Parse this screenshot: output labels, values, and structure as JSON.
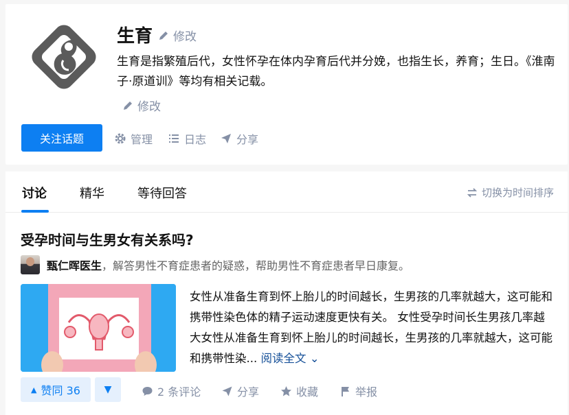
{
  "topic": {
    "title": "生育",
    "edit_label": "修改",
    "description": "生育是指繁殖后代，女性怀孕在体内孕育后代并分娩，也指生长，养育；生日。《淮南子·原道训》等均有相关记载。",
    "edit_label_2": "修改",
    "follow_button": "关注话题",
    "actions": {
      "manage": "管理",
      "log": "日志",
      "share": "分享"
    },
    "icon": "fetus-diamond-logo"
  },
  "tabs": {
    "items": [
      "讨论",
      "精华",
      "等待回答"
    ],
    "active": "讨论",
    "sort_toggle": "切换为时间排序"
  },
  "post": {
    "title": "受孕时间与生男女有关系吗?",
    "author_name": "甄仁晖医生",
    "author_bio": "，解答男性不育症患者的疑惑，帮助男性不育症患者早日康复。",
    "excerpt": "女性从准备生育到怀上胎儿的时间越长，生男孩的几率就越大，这可能和携带性染色体的精子运动速度更快有关。 女性受孕时间长生男孩几率越大女性从准备生育到怀上胎儿的时间越长，生男孩的几率就越大，这可能和携带性染...",
    "read_more": "阅读全文",
    "vote_label": "赞同 36",
    "comments": "2 条评论",
    "share": "分享",
    "favorite": "收藏",
    "report": "举报"
  },
  "colors": {
    "accent": "#0d7ff2",
    "muted": "#8590a6",
    "link": "#175199",
    "vote_bg": "#e5f0fd"
  }
}
